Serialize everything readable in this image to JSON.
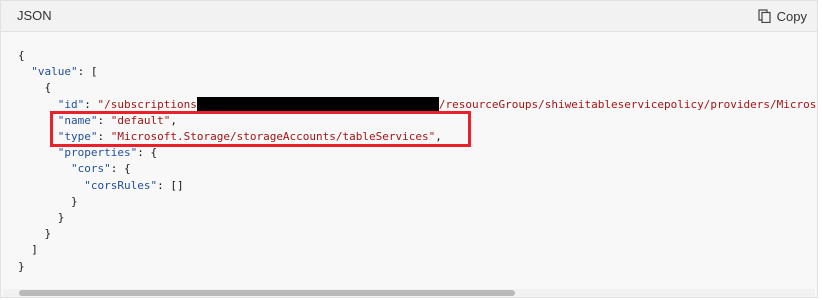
{
  "header": {
    "title": "JSON",
    "copy_label": "Copy",
    "copy_icon": "copy-icon"
  },
  "code": {
    "open_brace": "{",
    "value_key": "\"value\"",
    "value_open": ": [",
    "item_open": "{",
    "id_key": "\"id\"",
    "id_value_start": "\"/subscriptions",
    "id_value_end": "/resourceGroups/shiweitableservicepolicy/providers/Microso",
    "name_key": "\"name\"",
    "name_value": "\"default\"",
    "type_key": "\"type\"",
    "type_value": "\"Microsoft.Storage/storageAccounts/tableServices\"",
    "properties_key": "\"properties\"",
    "cors_key": "\"cors\"",
    "corsrules_key": "\"corsRules\"",
    "corsrules_value": "[]",
    "cors_close": "}",
    "properties_close": "}",
    "item_close": "}",
    "value_close": "]",
    "close_brace": "}"
  },
  "colors": {
    "highlight_border": "#e8212b",
    "key_color": "#1f4e9c",
    "string_color": "#a31515"
  }
}
